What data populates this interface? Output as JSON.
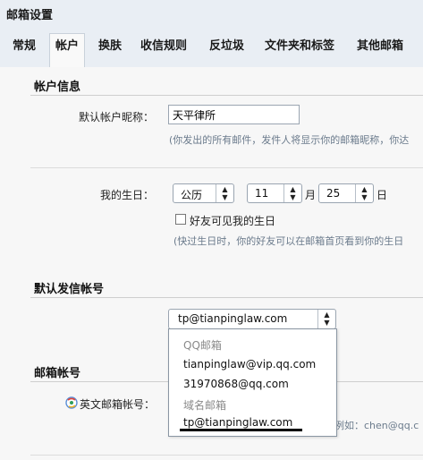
{
  "header": {
    "title": "邮箱设置"
  },
  "tabs": [
    {
      "label": "常规"
    },
    {
      "label": "帐户"
    },
    {
      "label": "换肤"
    },
    {
      "label": "收信规则"
    },
    {
      "label": "反垃圾"
    },
    {
      "label": "文件夹和标签"
    },
    {
      "label": "其他邮箱"
    }
  ],
  "active_tab": "帐户",
  "account_info": {
    "title": "帐户信息",
    "nickname_label": "默认帐户昵称：",
    "nickname_value": "天平律所",
    "nickname_hint": "(你发出的所有邮件，发件人将显示你的邮箱昵称，你达",
    "birthday_label": "我的生日：",
    "calendar_value": "公历",
    "month_value": "11",
    "month_unit": "月",
    "day_value": "25",
    "day_unit": "日",
    "birthday_visible_label": "好友可见我的生日",
    "birthday_hint": "(快过生日时，你的好友可以在邮箱首页看到你的生日"
  },
  "default_sender": {
    "title": "默认发信帐号",
    "selected": "tp@tianpinglaw.com",
    "options": [
      {
        "text": "QQ邮箱",
        "group": true
      },
      {
        "text": "tianpinglaw@vip.qq.com",
        "group": false
      },
      {
        "text": "31970868@qq.com",
        "group": false
      },
      {
        "text": "域名邮箱",
        "group": true
      },
      {
        "text": "tp@tianpinglaw.com",
        "group": false
      }
    ]
  },
  "mailbox_account": {
    "title": "邮箱帐号",
    "english_label": "英文邮箱帐号：",
    "hint_partial": "例如：chen@qq.c"
  },
  "colors": {
    "header_bg": "#e9eef4",
    "content_bg": "#f7f7f7",
    "hint": "#6b7b8c"
  }
}
